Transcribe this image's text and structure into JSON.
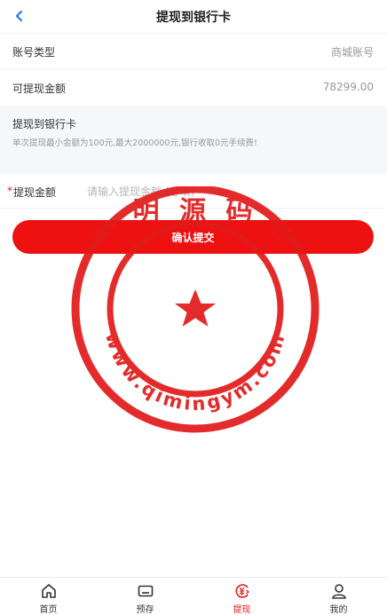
{
  "header": {
    "title": "提现到银行卡",
    "back_icon": "chevron-left-icon",
    "accent": "#1a73e8"
  },
  "account_type": {
    "label": "账号类型",
    "value": "商城账号"
  },
  "withdrawable": {
    "label": "可提现金额",
    "value": "78299.00"
  },
  "bank_section": {
    "title": "提现到银行卡",
    "note": "单次提现最小金额为100元,最大2000000元,银行收取0元手续费!"
  },
  "amount_field": {
    "required_mark": "*",
    "label": "提现金额",
    "placeholder": "请输入提现金额 (必填)",
    "value": ""
  },
  "confirm_button": {
    "label": "确认提交",
    "color": "#ee1111"
  },
  "watermark": {
    "top_text": "明 源 码",
    "url": "www.qimingym.com",
    "color": "#e21a1a"
  },
  "tabbar": {
    "active_color": "#e12020",
    "items": [
      {
        "label": "首页",
        "icon": "home-icon",
        "active": false
      },
      {
        "label": "预存",
        "icon": "card-icon",
        "active": false
      },
      {
        "label": "提现",
        "icon": "yuan-exchange-icon",
        "active": true
      },
      {
        "label": "我的",
        "icon": "user-icon",
        "active": false
      }
    ]
  }
}
